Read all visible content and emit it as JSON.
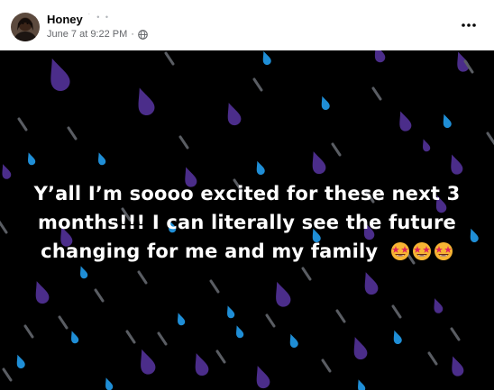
{
  "post": {
    "author": {
      "name": "Honey",
      "name_suffix": "˙ • •",
      "avatar_icon": "profile-photo"
    },
    "meta": {
      "timestamp": "June 7 at 9:22 PM",
      "separator": "·",
      "audience_icon": "globe-icon"
    },
    "more_icon": "more-horizontal-icon",
    "status": {
      "text": "Y’all I’m soooo excited for these next 3 months!!! I can literally see the future changing for me and my family",
      "emoji": [
        "star-struck-icon",
        "star-struck-icon",
        "star-struck-icon"
      ],
      "background": "#000000",
      "text_color": "#ffffff"
    }
  },
  "colors": {
    "purple_drop": "#4b2d8a",
    "blue_drop": "#1f8ed6",
    "gray_streak": "#5a5d63",
    "emoji_face": "#f7b533"
  }
}
